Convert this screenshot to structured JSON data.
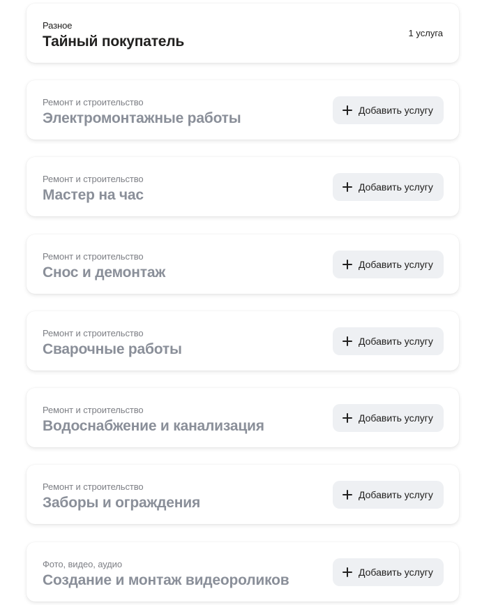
{
  "services": [
    {
      "category": "Разное",
      "title": "Тайный покупатель",
      "count_label": "1 услуга",
      "active": true
    },
    {
      "category": "Ремонт и строительство",
      "title": "Электромонтажные работы",
      "button_label": "Добавить услугу",
      "active": false
    },
    {
      "category": "Ремонт и строительство",
      "title": "Мастер на час",
      "button_label": "Добавить услугу",
      "active": false
    },
    {
      "category": "Ремонт и строительство",
      "title": "Снос и демонтаж",
      "button_label": "Добавить услугу",
      "active": false
    },
    {
      "category": "Ремонт и строительство",
      "title": "Сварочные работы",
      "button_label": "Добавить услугу",
      "active": false
    },
    {
      "category": "Ремонт и строительство",
      "title": "Водоснабжение и канализация",
      "button_label": "Добавить услугу",
      "active": false
    },
    {
      "category": "Ремонт и строительство",
      "title": "Заборы и ограждения",
      "button_label": "Добавить услугу",
      "active": false
    },
    {
      "category": "Фото, видео, аудио",
      "title": "Создание и монтаж видеороликов",
      "button_label": "Добавить услугу",
      "active": false
    }
  ]
}
